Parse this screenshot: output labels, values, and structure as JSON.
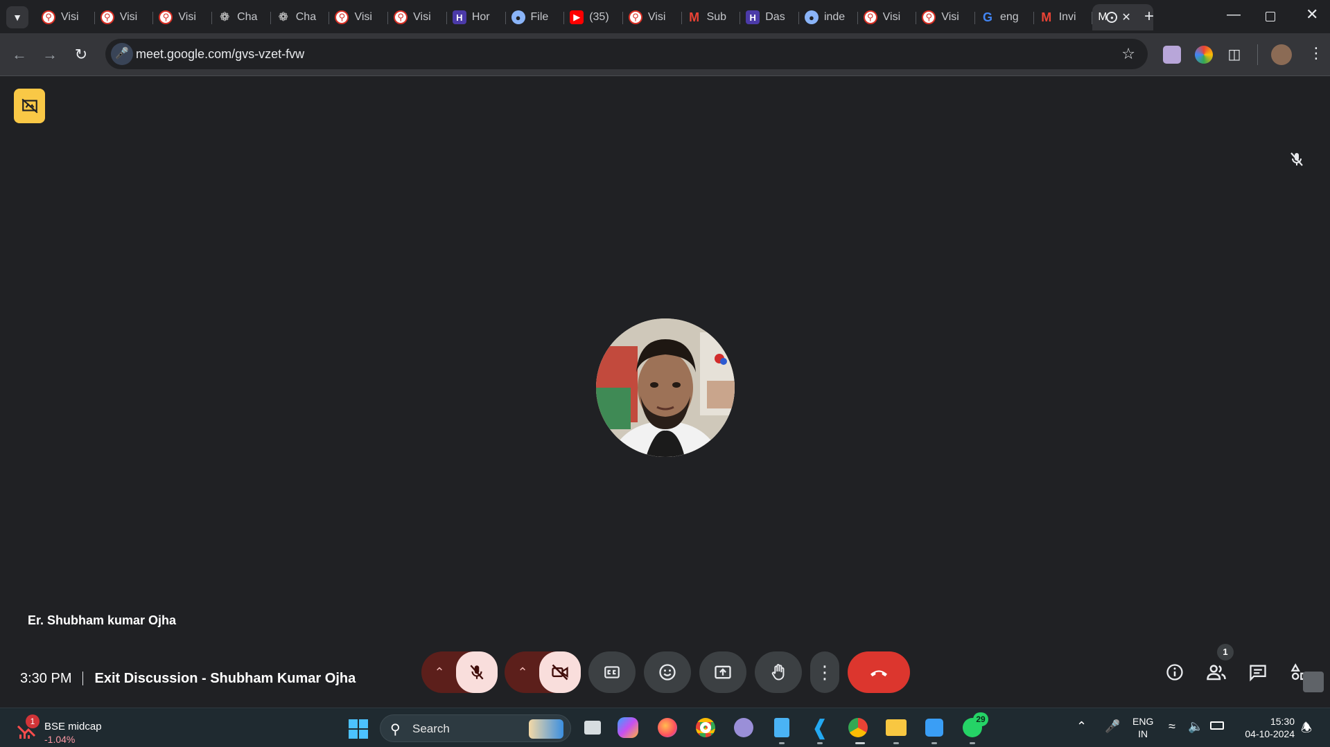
{
  "browser": {
    "tabs": [
      {
        "title": "Visi",
        "favicon": "red-magnifier-icon"
      },
      {
        "title": "Visi",
        "favicon": "red-magnifier-icon"
      },
      {
        "title": "Visi",
        "favicon": "red-magnifier-icon"
      },
      {
        "title": "Cha",
        "favicon": "chatgpt-icon"
      },
      {
        "title": "Cha",
        "favicon": "chatgpt-icon"
      },
      {
        "title": "Visi",
        "favicon": "red-magnifier-icon"
      },
      {
        "title": "Visi",
        "favicon": "red-magnifier-icon"
      },
      {
        "title": "Hor",
        "favicon": "purple-logo-icon"
      },
      {
        "title": "File",
        "favicon": "blue-globe-icon"
      },
      {
        "title": "(35)",
        "favicon": "youtube-icon"
      },
      {
        "title": "Visi",
        "favicon": "red-magnifier-icon"
      },
      {
        "title": "Sub",
        "favicon": "gmail-icon"
      },
      {
        "title": "Das",
        "favicon": "purple-logo-icon"
      },
      {
        "title": "inde",
        "favicon": "blue-globe-icon"
      },
      {
        "title": "Visi",
        "favicon": "red-magnifier-icon"
      },
      {
        "title": "Visi",
        "favicon": "red-magnifier-icon"
      },
      {
        "title": "eng",
        "favicon": "google-icon"
      },
      {
        "title": "Invi",
        "favicon": "gmail-icon"
      }
    ],
    "active_tab": {
      "title": "M",
      "favicon": "recording-icon"
    },
    "new_tab": "+",
    "url": "meet.google.com/gvs-vzet-fvw"
  },
  "meet": {
    "participant_name": "Er. Shubham kumar Ojha",
    "time": "3:30 PM",
    "title": "Exit Discussion - Shubham Kumar Ojha",
    "people_count": "1",
    "colors": {
      "hangup": "#dc362e",
      "muted": "#f9dedc",
      "host_badge": "#f9c846"
    }
  },
  "taskbar": {
    "stock_badge": "1",
    "stock_name": "BSE midcap",
    "stock_change": "-1.04%",
    "search_label": "Search",
    "whatsapp_badge": "29",
    "lang_line1": "ENG",
    "lang_line2": "IN",
    "time": "15:30",
    "date": "04-10-2024"
  }
}
